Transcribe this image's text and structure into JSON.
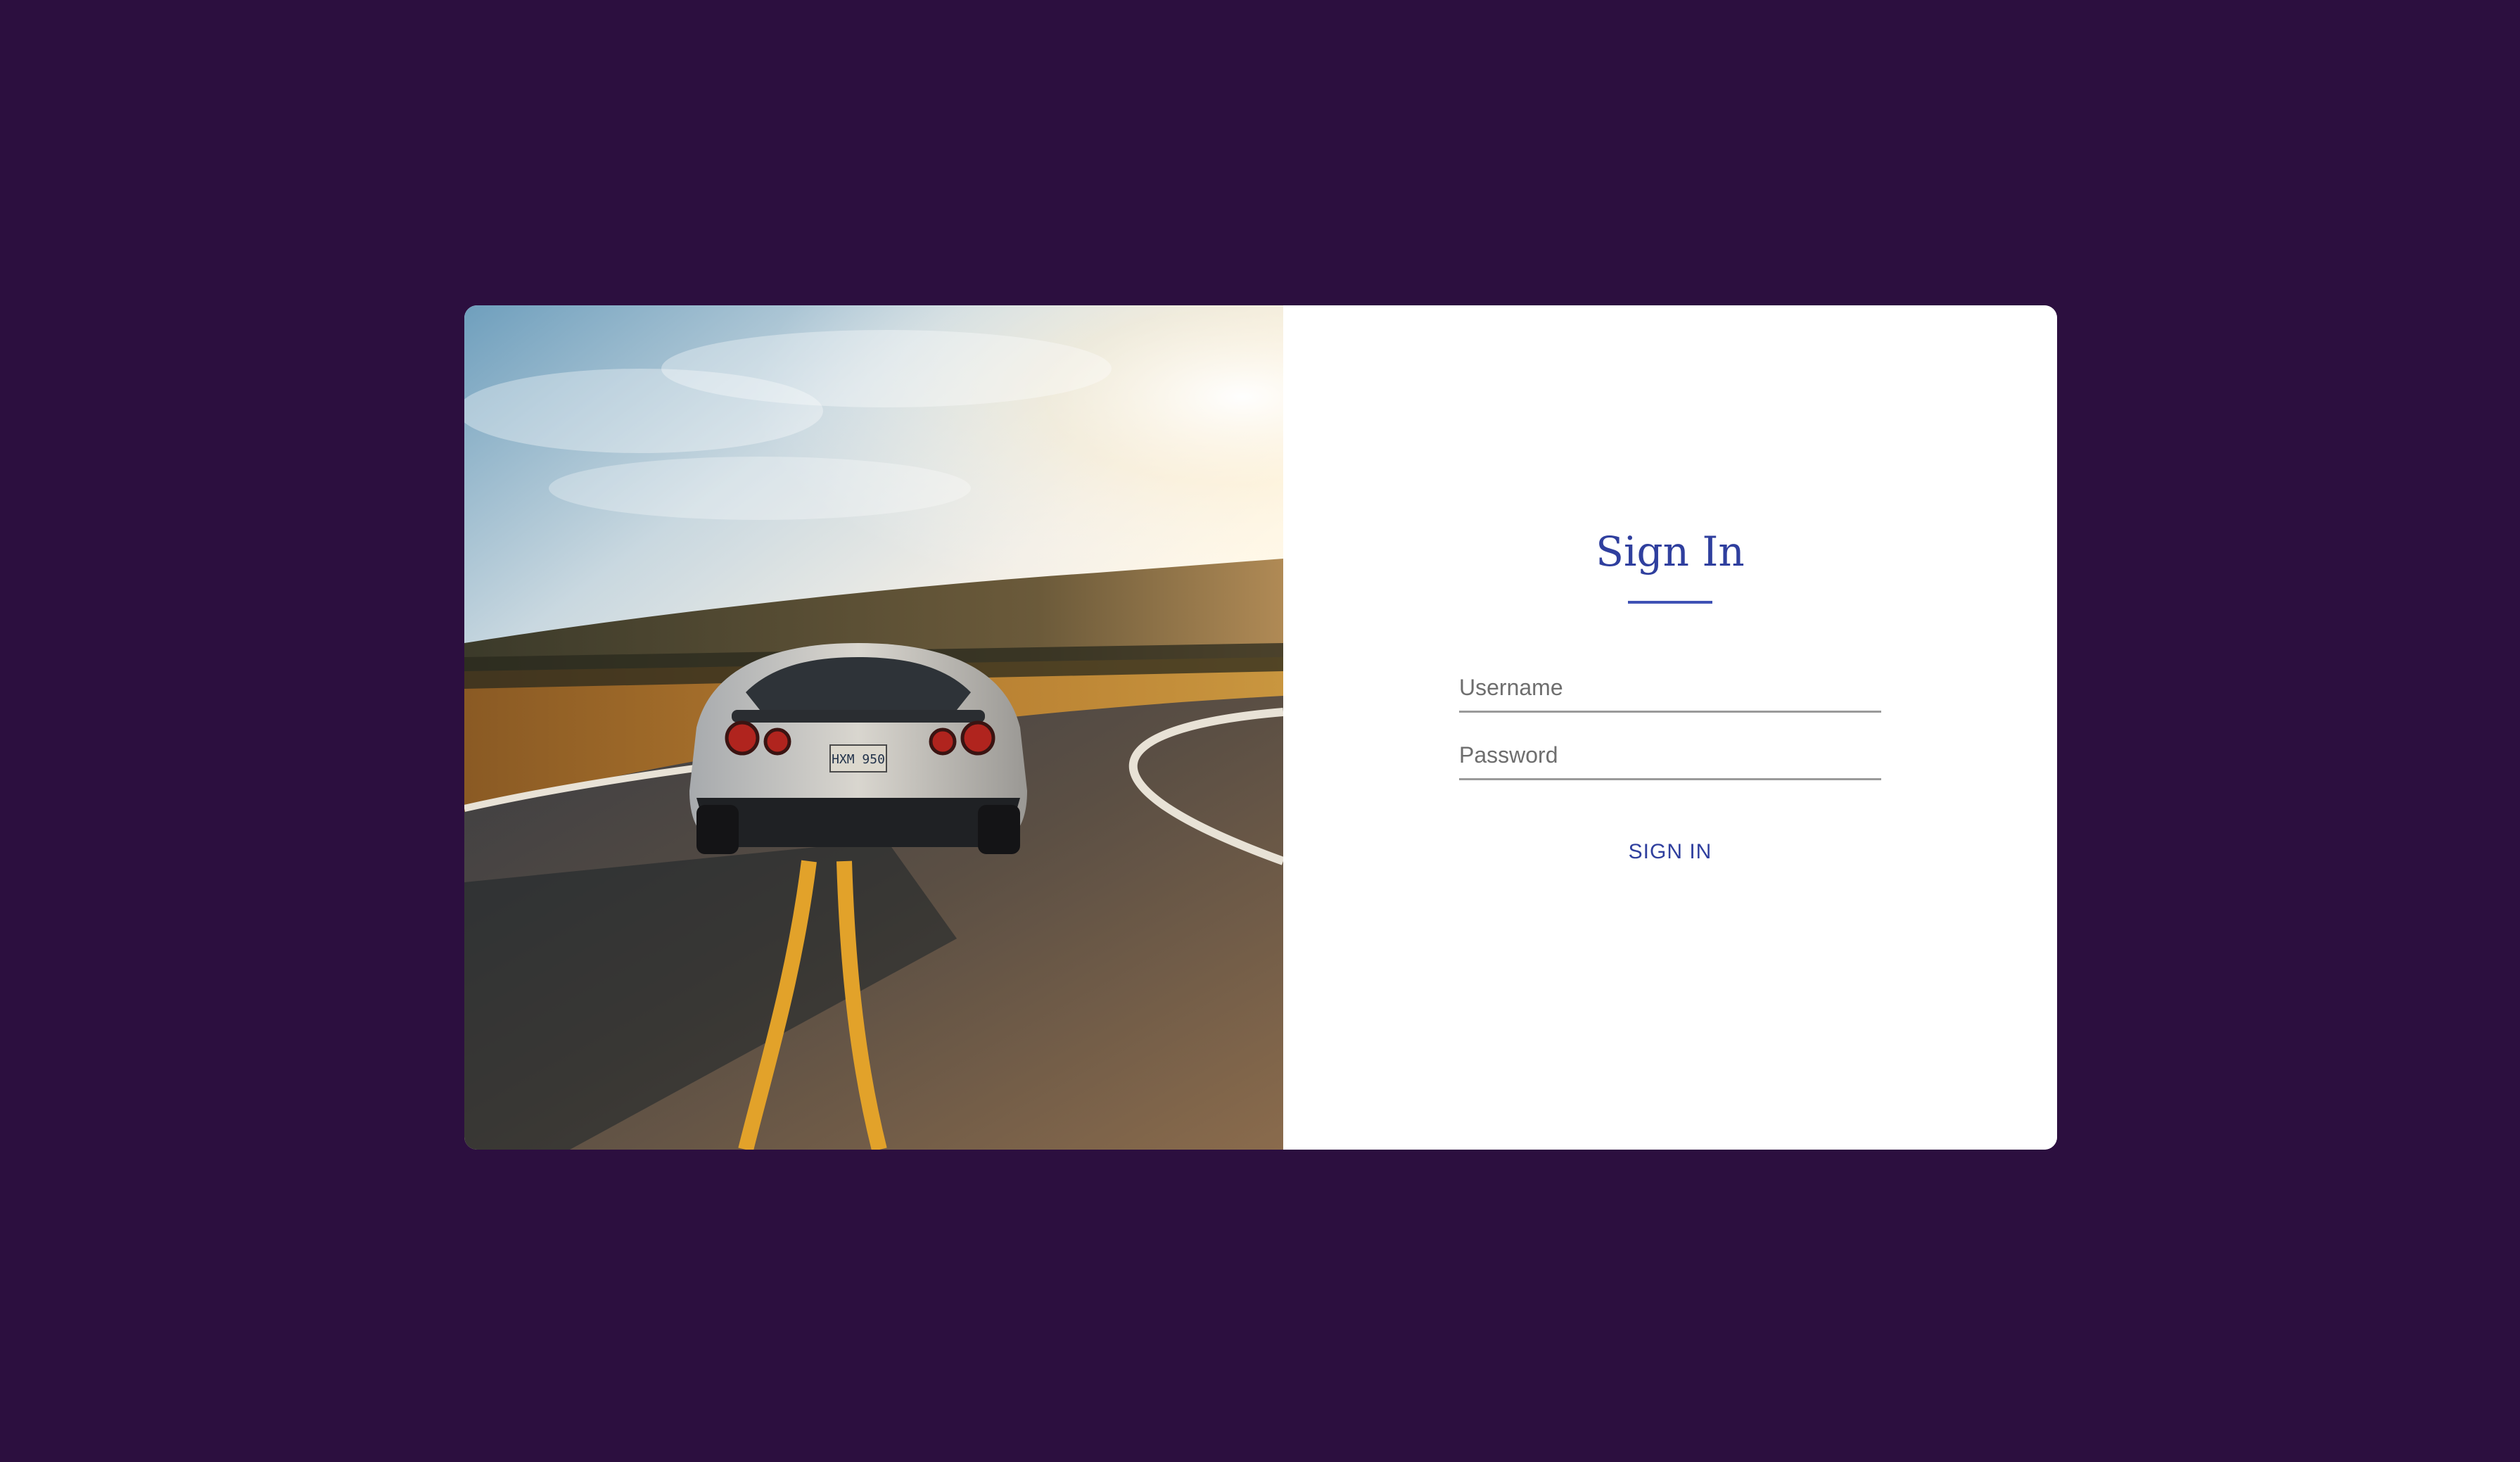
{
  "login": {
    "title": "Sign In",
    "username_placeholder": "Username",
    "password_placeholder": "Password",
    "signin_label": "SIGN IN"
  },
  "colors": {
    "background": "#2c0f3f",
    "accent": "#3f51b5",
    "card": "#ffffff"
  },
  "photo": {
    "license_plate": "HXM 950"
  }
}
